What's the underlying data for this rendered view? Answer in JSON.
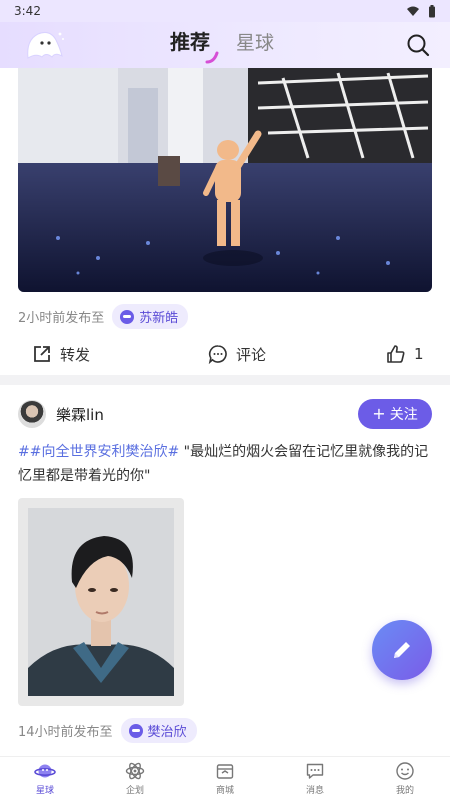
{
  "status_bar": {
    "time": "3:42"
  },
  "header": {
    "tabs": [
      {
        "label": "推荐",
        "active": true
      },
      {
        "label": "星球",
        "active": false
      }
    ]
  },
  "post1": {
    "meta_text": "2小时前发布至",
    "chip_label": "苏新皓",
    "actions": {
      "share_label": "转发",
      "comment_label": "评论",
      "like_count": "1"
    }
  },
  "post2": {
    "author": "樂霖lin",
    "follow_label": "关注",
    "hashtag": "##向全世界安利樊治欣#",
    "quote": " \"最灿烂的烟火会留在记忆里就像我的记忆里都是带着光的你\"",
    "meta_text": "14小时前发布至",
    "chip_label": "樊治欣"
  },
  "bottom_nav": [
    {
      "label": "星球",
      "icon": "planet-icon",
      "active": true
    },
    {
      "label": "企划",
      "icon": "atom-icon",
      "active": false
    },
    {
      "label": "商城",
      "icon": "shop-icon",
      "active": false
    },
    {
      "label": "消息",
      "icon": "message-icon",
      "active": false
    },
    {
      "label": "我的",
      "icon": "smile-icon",
      "active": false
    }
  ],
  "colors": {
    "accent": "#6c5ce7",
    "hashtag": "#5a6fe0",
    "header_bg": "#e6ddff"
  }
}
